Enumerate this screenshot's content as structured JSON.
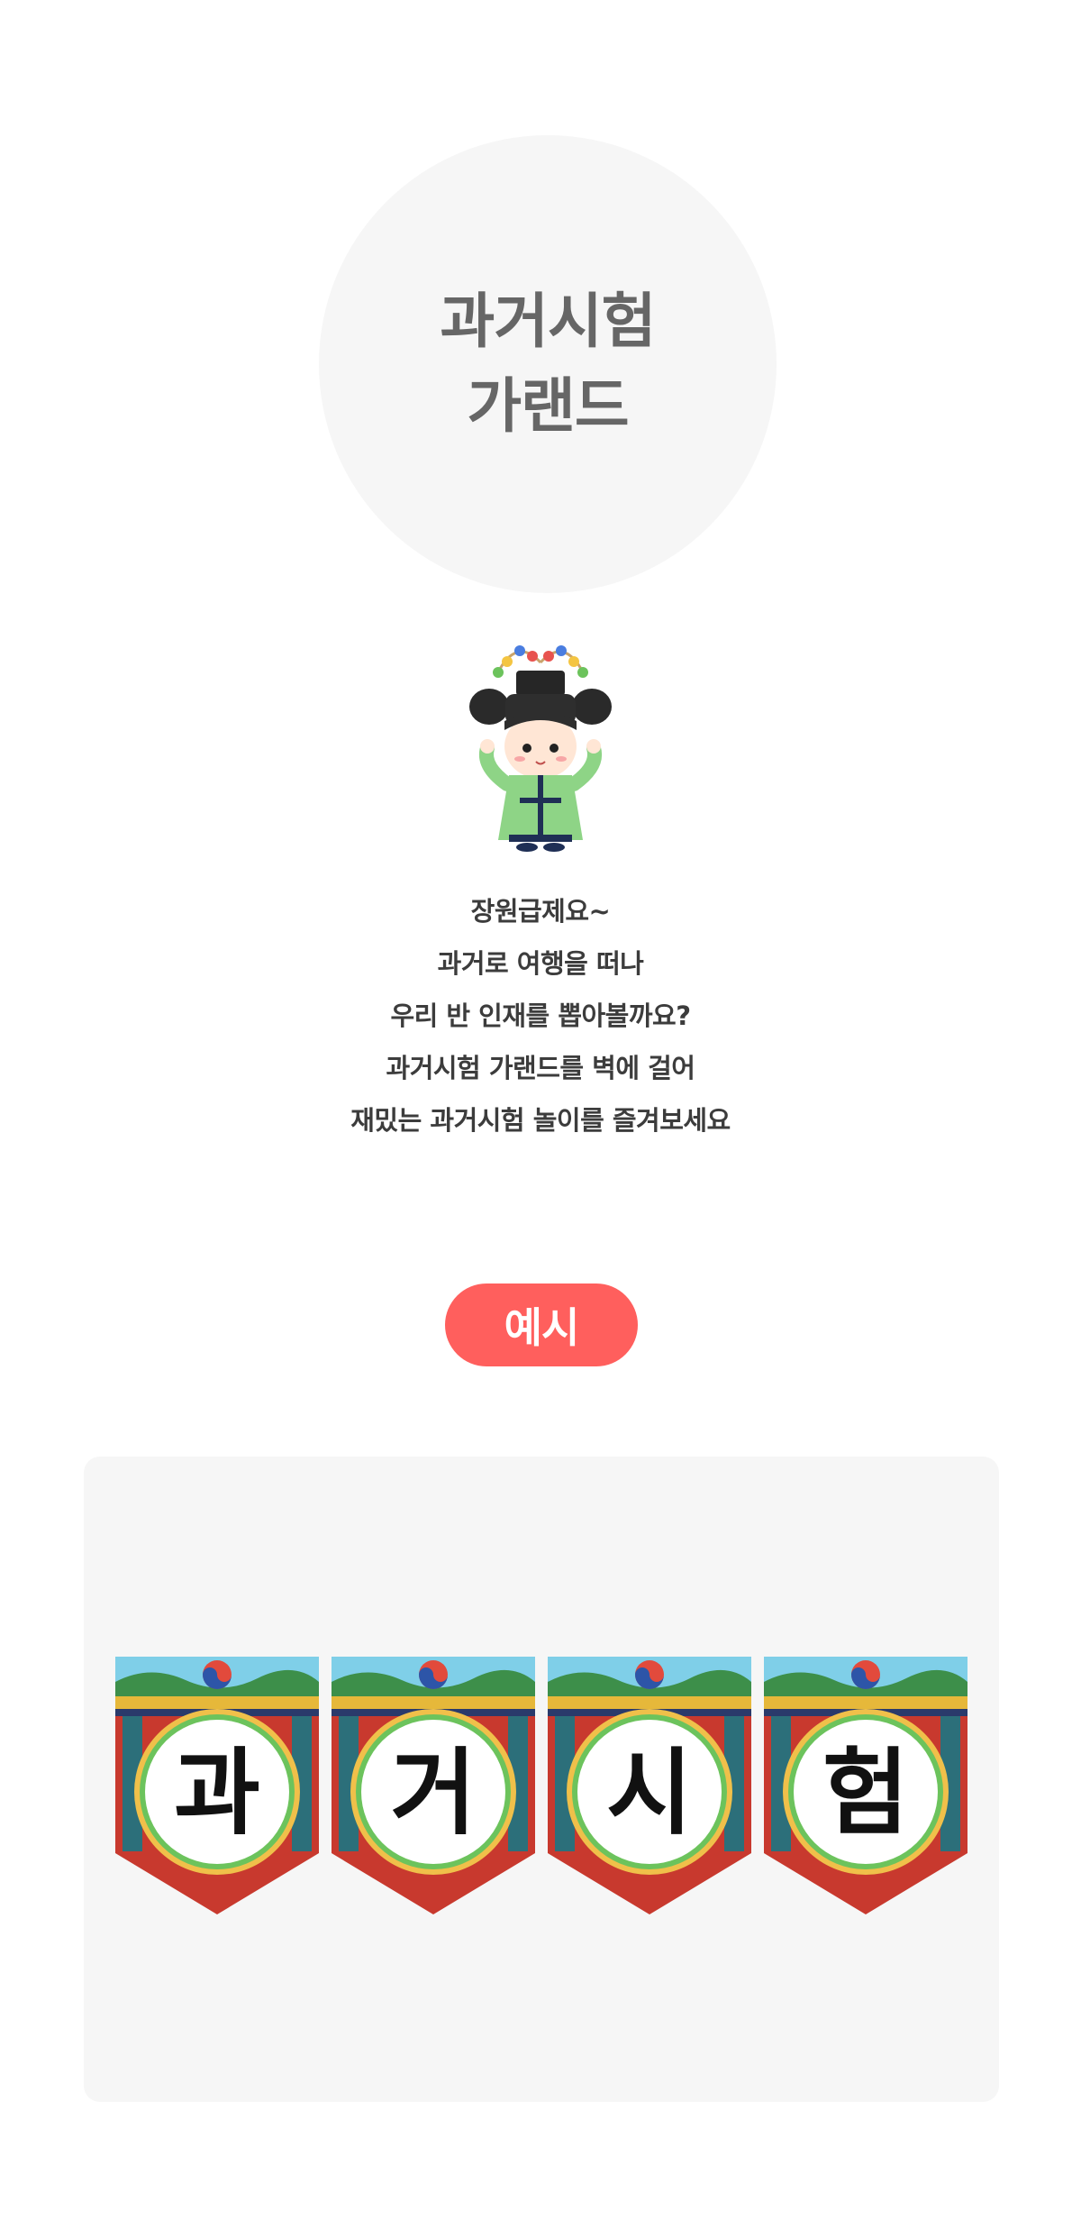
{
  "hero": {
    "title_line1": "과거시험",
    "title_line2": "가랜드"
  },
  "character": {
    "icon": "scholar-character-icon"
  },
  "description": {
    "lines": [
      "장원급제요~",
      "과거로 여행을 떠나",
      "우리 반 인재를 뽑아볼까요?",
      "과거시험 가랜드를 벽에 걸어",
      "재밌는 과거시험 놀이를 즐겨보세요"
    ]
  },
  "example": {
    "label": "예시"
  },
  "garland": {
    "letters": [
      "과",
      "거",
      "시",
      "험"
    ]
  },
  "colors": {
    "accent": "#ff5f5d",
    "hero_bg": "#f6f6f6",
    "title_text": "#666666"
  }
}
